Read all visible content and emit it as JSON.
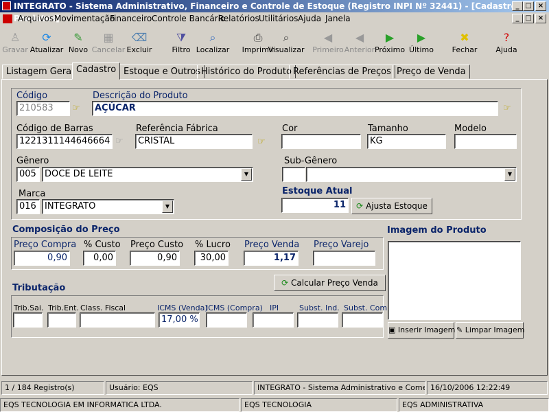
{
  "window": {
    "title": "INTEGRATO - Sistema Administrativo, Financeiro e Controle de Estoque (Registro INPI Nº 32441) - [Cadastro de Produtos]"
  },
  "menu": [
    "Arquivos",
    "Movimentação",
    "Financeiro",
    "Controle Bancário",
    "Relatórios",
    "Utilitários",
    "Ajuda",
    "Janela"
  ],
  "toolbar": [
    {
      "label": "Gravar",
      "icon": "save-icon",
      "enabled": false
    },
    {
      "label": "Atualizar",
      "icon": "refresh-icon",
      "enabled": true
    },
    {
      "label": "Novo",
      "icon": "new-icon",
      "enabled": true
    },
    {
      "label": "Cancelar",
      "icon": "cancel-icon",
      "enabled": false
    },
    {
      "label": "Excluir",
      "icon": "delete-icon",
      "enabled": true
    },
    {
      "label": "Filtro",
      "icon": "filter-icon",
      "enabled": true
    },
    {
      "label": "Localizar",
      "icon": "search-icon",
      "enabled": true
    },
    {
      "label": "Imprimir",
      "icon": "printer-icon",
      "enabled": true
    },
    {
      "label": "Visualizar",
      "icon": "preview-icon",
      "enabled": true
    },
    {
      "label": "Primeiro",
      "icon": "first-icon",
      "enabled": false
    },
    {
      "label": "Anterior",
      "icon": "previous-icon",
      "enabled": false
    },
    {
      "label": "Próximo",
      "icon": "next-icon",
      "enabled": true
    },
    {
      "label": "Último",
      "icon": "last-icon",
      "enabled": true
    },
    {
      "label": "Fechar",
      "icon": "close-icon",
      "enabled": true
    },
    {
      "label": "Ajuda",
      "icon": "help-icon",
      "enabled": true
    }
  ],
  "tabs": [
    "Listagem Geral",
    "Cadastro",
    "Estoque e Outros",
    "Histórico do Produto",
    "Referências de Preços",
    "Preço de Venda"
  ],
  "active_tab": "Cadastro",
  "form": {
    "codigo_label": "Código",
    "codigo": "210583",
    "descricao_label": "Descrição do Produto",
    "descricao": "AÇÚCAR",
    "barras_label": "Código de Barras",
    "barras": "1221311144646664",
    "ref_label": "Referência Fábrica",
    "ref": "CRISTAL",
    "cor_label": "Cor",
    "cor": "",
    "tamanho_label": "Tamanho",
    "tamanho": "KG",
    "modelo_label": "Modelo",
    "modelo": "",
    "genero_label": "Gênero",
    "genero_cod": "005",
    "genero": "DOCE DE LEITE",
    "subgenero_label": "Sub-Gênero",
    "subgenero_cod": "",
    "subgenero": "",
    "marca_label": "Marca",
    "marca_cod": "016",
    "marca": "INTEGRATO",
    "estoque_label": "Estoque Atual",
    "estoque": "11",
    "ajusta_label": "Ajusta Estoque"
  },
  "preco": {
    "title": "Composição do Preço",
    "labels": [
      "Preço Compra",
      "% Custo",
      "Preço Custo",
      "% Lucro",
      "Preço Venda",
      "Preço Varejo"
    ],
    "values": [
      "0,90",
      "0,00",
      "0,90",
      "30,00",
      "1,17",
      ""
    ],
    "calc_label": "Calcular Preço Venda"
  },
  "trib": {
    "title": "Tributação",
    "labels": [
      "Trib.Sai.",
      "Trib.Ent.",
      "Class. Fiscal",
      "ICMS (Venda)",
      "ICMS (Compra)",
      "IPI",
      "Subst. Ind.",
      "Subst. Com."
    ],
    "values": [
      "",
      "",
      "",
      "17,00 %",
      "",
      "",
      "",
      ""
    ]
  },
  "imagem": {
    "title": "Imagem do Produto",
    "inserir": "Inserir Imagem",
    "limpar": "Limpar Imagem"
  },
  "status": [
    "1 / 184 Registro(s)",
    "Usuário: EQS",
    "INTEGRATO - Sistema Administrativo e Comercial",
    "16/10/2006 12:22:49"
  ],
  "status2": [
    "EQS TECNOLOGIA EM INFORMATICA LTDA.",
    "EQS TECNOLOGIA",
    "EQS ADMINISTRATIVA"
  ]
}
